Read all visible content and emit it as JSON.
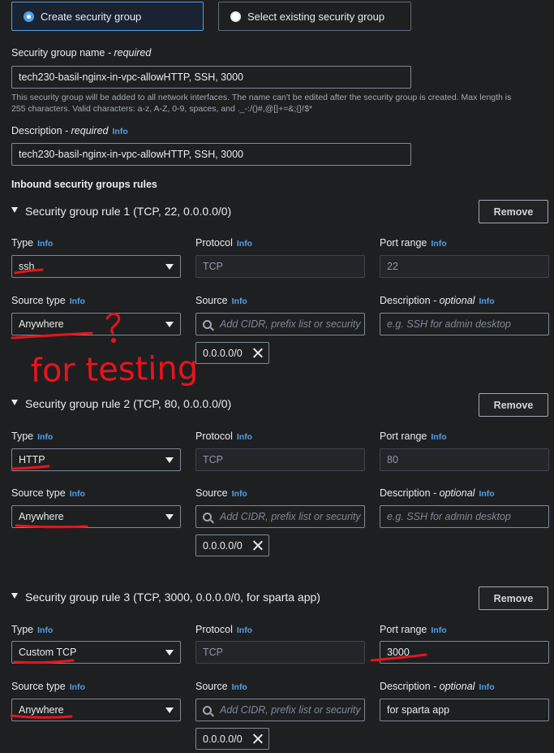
{
  "choice": {
    "create_label": "Create security group",
    "select_label": "Select existing security group"
  },
  "name_field": {
    "label": "Security group name",
    "required": " - required",
    "value": "tech230-basil-nginx-in-vpc-allowHTTP, SSH, 3000",
    "help_line1": "This security group will be added to all network interfaces. The name can't be edited after the security group is created. Max length is",
    "help_line2": "255 characters. Valid characters: a-z, A-Z, 0-9, spaces, and ._-:/()#,@[]+=&;{}!$*"
  },
  "description_field": {
    "label": "Description",
    "required": " - required",
    "info": "Info",
    "value": "tech230-basil-nginx-in-vpc-allowHTTP, SSH, 3000"
  },
  "inbound_title": "Inbound security groups rules",
  "common": {
    "info": "Info",
    "type": "Type",
    "protocol": "Protocol",
    "port_range": "Port range",
    "source_type": "Source type",
    "source": "Source",
    "description": "Description",
    "optional": " - optional",
    "remove": "Remove",
    "source_placeholder": "Add CIDR, prefix list or security",
    "desc_placeholder": "e.g. SSH for admin desktop"
  },
  "rules": [
    {
      "title": "Security group rule 1 (TCP, 22, 0.0.0.0/0)",
      "type": "ssh",
      "protocol": "TCP",
      "port": "22",
      "source_type": "Anywhere",
      "token": "0.0.0.0/0",
      "description": ""
    },
    {
      "title": "Security group rule 2 (TCP, 80, 0.0.0.0/0)",
      "type": "HTTP",
      "protocol": "TCP",
      "port": "80",
      "source_type": "Anywhere",
      "token": "0.0.0.0/0",
      "description": ""
    },
    {
      "title": "Security group rule 3 (TCP, 3000, 0.0.0.0/0, for sparta app)",
      "type": "Custom TCP",
      "protocol": "TCP",
      "port": "3000",
      "source_type": "Anywhere",
      "token": "0.0.0.0/0",
      "description": "for sparta app"
    }
  ],
  "annotations": {
    "question_mark": "?",
    "handwritten_note": "for testing",
    "ink_color": "#e8141b"
  },
  "colors": {
    "accent": "#539fe5",
    "background": "#1e1f21"
  }
}
